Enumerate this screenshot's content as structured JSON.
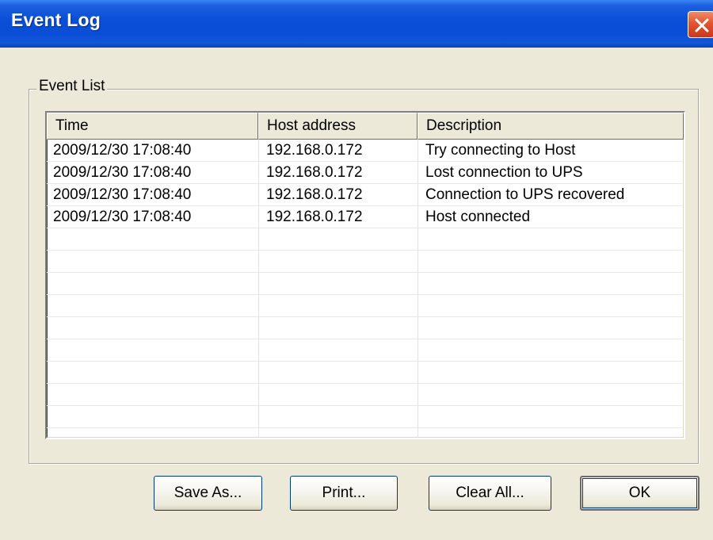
{
  "window": {
    "title": "Event Log"
  },
  "group": {
    "label": "Event List"
  },
  "table": {
    "columns": [
      "Time",
      "Host address",
      "Description"
    ],
    "rows": [
      {
        "time": "2009/12/30 17:08:40",
        "host": "192.168.0.172",
        "description": "Try connecting to Host"
      },
      {
        "time": "2009/12/30 17:08:40",
        "host": "192.168.0.172",
        "description": "Lost connection to UPS"
      },
      {
        "time": "2009/12/30 17:08:40",
        "host": "192.168.0.172",
        "description": "Connection to UPS recovered"
      },
      {
        "time": "2009/12/30 17:08:40",
        "host": "192.168.0.172",
        "description": "Host connected"
      }
    ]
  },
  "buttons": {
    "save_as": "Save As...",
    "print": "Print...",
    "clear_all": "Clear All...",
    "ok": "OK"
  },
  "colors": {
    "titlebar": "#0a4fd8",
    "close": "#e2552f",
    "window_bg": "#ece9d8"
  }
}
